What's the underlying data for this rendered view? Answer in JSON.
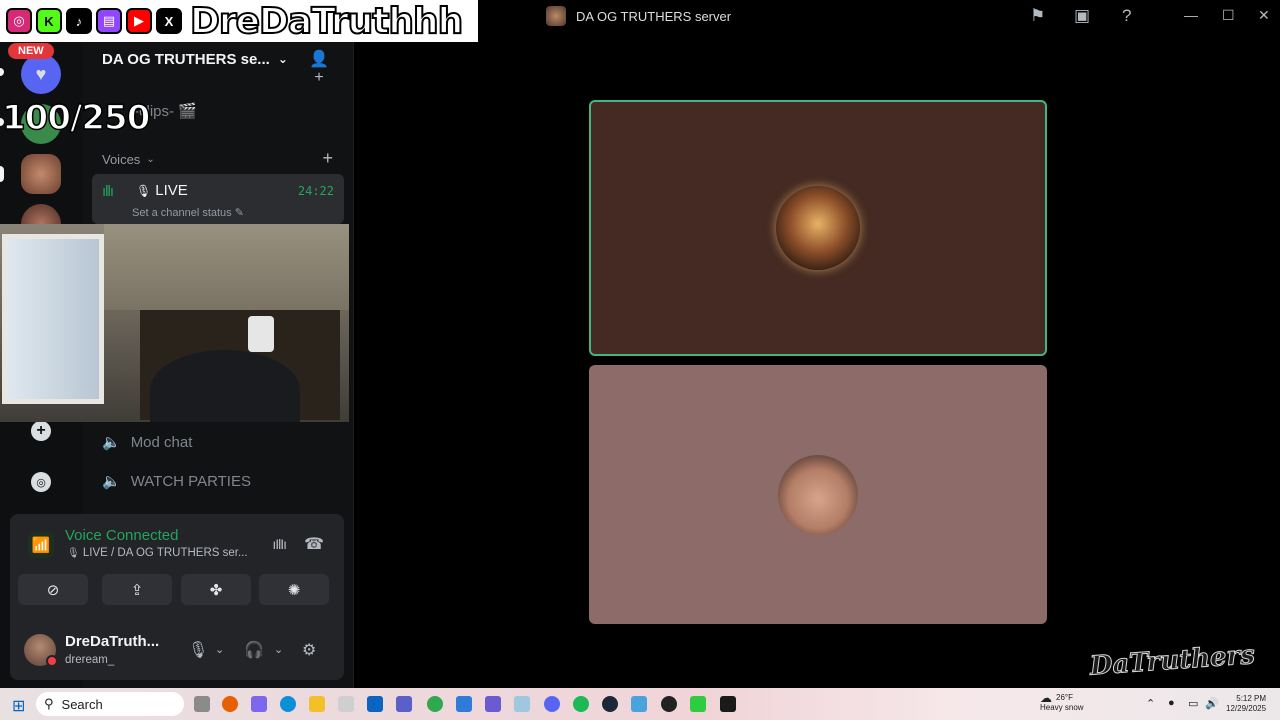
{
  "overlay": {
    "handle": "DreDaTruthhh",
    "new_badge": "NEW",
    "sub_goal": "100/250",
    "watermark": "DaTruthers",
    "socials": [
      "instagram-icon",
      "kick-icon",
      "tiktok-icon",
      "twitch-icon",
      "youtube-icon",
      "x-icon"
    ]
  },
  "window": {
    "title": "DA OG TRUTHERS server"
  },
  "server": {
    "name": "DA OG TRUTHERS se...",
    "partial_channel": "-clips-",
    "category": "Voices",
    "voice_channel": {
      "name": "LIVE",
      "timer": "24:22",
      "status_placeholder": "Set a channel status"
    },
    "channels": [
      "Mod chat",
      "WATCH PARTIES"
    ]
  },
  "voice_panel": {
    "title": "Voice Connected",
    "subtitle": "LIVE / DA OG TRUTHERS ser..."
  },
  "user": {
    "display_name": "DreDaTruth...",
    "username": "dreream_"
  },
  "taskbar": {
    "search_label": "Search",
    "weather_temp": "26°F",
    "weather_desc": "Heavy snow",
    "time": "5:12 PM",
    "date": "12/29/2025"
  },
  "colors": {
    "voice_green": "#23a55a",
    "speaking_border": "#43b581",
    "tile1_bg": "#442a22",
    "tile2_bg": "#8c6b68",
    "dnd_red": "#f23f43"
  }
}
